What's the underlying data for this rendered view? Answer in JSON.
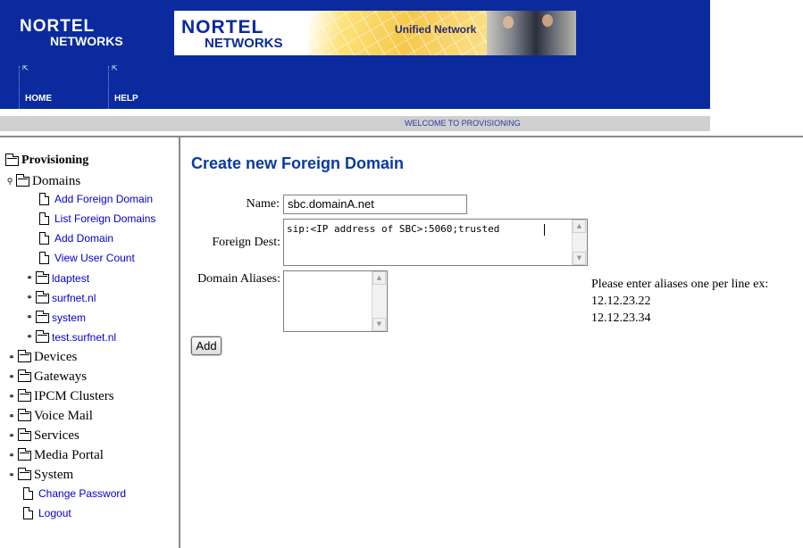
{
  "header": {
    "logo_text_line1": "NORTEL",
    "logo_text_line2": "NETWORKS",
    "banner_logo_line1": "NORTEL",
    "banner_logo_line2": "NETWORKS",
    "banner_tagline": "Unified Network",
    "nav": [
      {
        "label": "HOME",
        "icon": "small-arrow-icon"
      },
      {
        "label": "HELP",
        "icon": "small-arrow-icon"
      }
    ],
    "welcome": "WELCOME TO PROVISIONING",
    "colors": {
      "header_bg": "#0a2a9e",
      "welcome_bg": "#cfcfcf",
      "link": "#0000cc",
      "title": "#0a3aa0"
    }
  },
  "tree": {
    "root": "Provisioning",
    "domains": {
      "label": "Domains",
      "actions": [
        "Add Foreign Domain",
        "List Foreign Domains",
        "Add Domain",
        "View User Count"
      ],
      "children": [
        "ldaptest",
        "surfnet.nl",
        "system",
        "test.surfnet.nl"
      ]
    },
    "sections": [
      "Devices",
      "Gateways",
      "IPCM Clusters",
      "Voice Mail",
      "Services",
      "Media Portal",
      "System"
    ],
    "bottom_links": [
      "Change Password",
      "Logout"
    ]
  },
  "form": {
    "title": "Create new Foreign Domain",
    "name_label": "Name:",
    "name_value": "sbc.domainA.net",
    "foreign_dest_label": "Foreign Dest:",
    "foreign_dest_value": "sip:<IP address of SBC>:5060;trusted",
    "aliases_label": "Domain Aliases:",
    "aliases_value": "",
    "add_button": "Add",
    "hint_line1": "Please enter aliases one per line ex:",
    "hint_line2": "12.12.23.22",
    "hint_line3": "12.12.23.34"
  }
}
